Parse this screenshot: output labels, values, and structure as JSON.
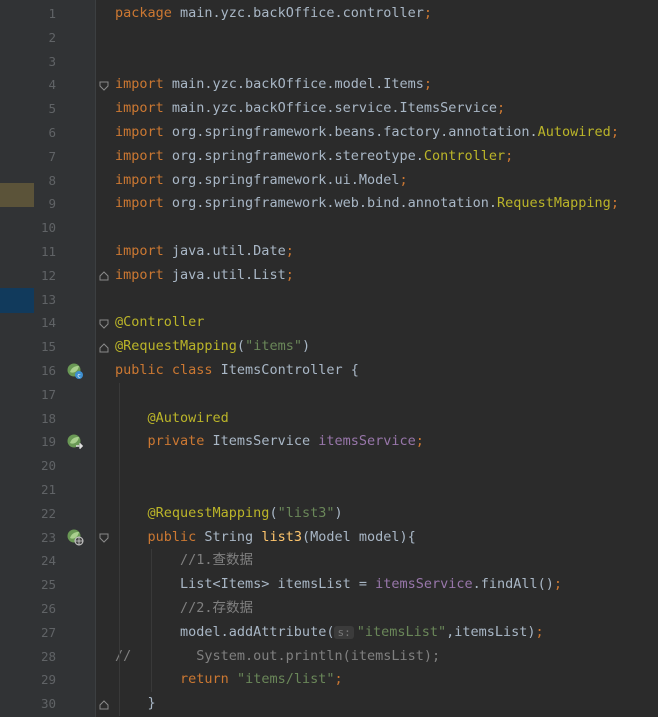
{
  "editor": {
    "lines": [
      {
        "num": "1",
        "parts": [
          {
            "t": "kw",
            "v": "package "
          },
          {
            "t": "plain",
            "v": "main.yzc.backOffice.controller"
          },
          {
            "t": "kw",
            "v": ";"
          }
        ]
      },
      {
        "num": "2",
        "parts": []
      },
      {
        "num": "3",
        "parts": []
      },
      {
        "num": "4",
        "fold": "open",
        "parts": [
          {
            "t": "kw",
            "v": "import "
          },
          {
            "t": "plain",
            "v": "main.yzc.backOffice.model.Items"
          },
          {
            "t": "kw",
            "v": ";"
          }
        ]
      },
      {
        "num": "5",
        "parts": [
          {
            "t": "kw",
            "v": "import "
          },
          {
            "t": "plain",
            "v": "main.yzc.backOffice.service.ItemsService"
          },
          {
            "t": "kw",
            "v": ";"
          }
        ]
      },
      {
        "num": "6",
        "parts": [
          {
            "t": "kw",
            "v": "import "
          },
          {
            "t": "plain",
            "v": "org.springframework.beans.factory.annotation."
          },
          {
            "t": "ann",
            "v": "Autowired"
          },
          {
            "t": "kw",
            "v": ";"
          }
        ]
      },
      {
        "num": "7",
        "parts": [
          {
            "t": "kw",
            "v": "import "
          },
          {
            "t": "plain",
            "v": "org.springframework.stereotype."
          },
          {
            "t": "ann",
            "v": "Controller"
          },
          {
            "t": "kw",
            "v": ";"
          }
        ]
      },
      {
        "num": "8",
        "parts": [
          {
            "t": "kw",
            "v": "import "
          },
          {
            "t": "plain",
            "v": "org.springframework.ui.Model"
          },
          {
            "t": "kw",
            "v": ";"
          }
        ]
      },
      {
        "num": "9",
        "parts": [
          {
            "t": "kw",
            "v": "import "
          },
          {
            "t": "plain",
            "v": "org.springframework.web.bind.annotation."
          },
          {
            "t": "ann",
            "v": "RequestMapping"
          },
          {
            "t": "kw",
            "v": ";"
          }
        ]
      },
      {
        "num": "10",
        "parts": []
      },
      {
        "num": "11",
        "parts": [
          {
            "t": "kw",
            "v": "import "
          },
          {
            "t": "plain",
            "v": "java.util.Date"
          },
          {
            "t": "kw",
            "v": ";"
          }
        ]
      },
      {
        "num": "12",
        "fold": "close",
        "parts": [
          {
            "t": "kw",
            "v": "import "
          },
          {
            "t": "plain",
            "v": "java.util.List"
          },
          {
            "t": "kw",
            "v": ";"
          }
        ]
      },
      {
        "num": "13",
        "parts": []
      },
      {
        "num": "14",
        "fold": "open",
        "parts": [
          {
            "t": "ann",
            "v": "@Controller"
          }
        ]
      },
      {
        "num": "15",
        "fold": "close",
        "parts": [
          {
            "t": "ann",
            "v": "@RequestMapping"
          },
          {
            "t": "plain",
            "v": "("
          },
          {
            "t": "str",
            "v": "\"items\""
          },
          {
            "t": "plain",
            "v": ")"
          }
        ]
      },
      {
        "num": "16",
        "icon": "spring-bean-icon",
        "parts": [
          {
            "t": "kw",
            "v": "public class "
          },
          {
            "t": "plain",
            "v": "ItemsController {"
          }
        ]
      },
      {
        "num": "17",
        "parts": []
      },
      {
        "num": "18",
        "parts": [
          {
            "t": "plain",
            "v": "    "
          },
          {
            "t": "ann",
            "v": "@Autowired"
          }
        ]
      },
      {
        "num": "19",
        "icon": "spring-autowired-icon",
        "parts": [
          {
            "t": "plain",
            "v": "    "
          },
          {
            "t": "kw",
            "v": "private "
          },
          {
            "t": "plain",
            "v": "ItemsService "
          },
          {
            "t": "fld",
            "v": "itemsService"
          },
          {
            "t": "kw",
            "v": ";"
          }
        ]
      },
      {
        "num": "20",
        "parts": []
      },
      {
        "num": "21",
        "parts": []
      },
      {
        "num": "22",
        "parts": [
          {
            "t": "plain",
            "v": "    "
          },
          {
            "t": "ann",
            "v": "@RequestMapping"
          },
          {
            "t": "plain",
            "v": "("
          },
          {
            "t": "str",
            "v": "\"list3\""
          },
          {
            "t": "plain",
            "v": ")"
          }
        ]
      },
      {
        "num": "23",
        "icon": "spring-web-icon",
        "fold": "open",
        "parts": [
          {
            "t": "plain",
            "v": "    "
          },
          {
            "t": "kw",
            "v": "public "
          },
          {
            "t": "plain",
            "v": "String "
          },
          {
            "t": "fn",
            "v": "list3"
          },
          {
            "t": "plain",
            "v": "(Model model){"
          }
        ]
      },
      {
        "num": "24",
        "parts": [
          {
            "t": "plain",
            "v": "        "
          },
          {
            "t": "com",
            "v": "//1.查数据"
          }
        ]
      },
      {
        "num": "25",
        "parts": [
          {
            "t": "plain",
            "v": "        List<Items> itemsList = "
          },
          {
            "t": "fld",
            "v": "itemsService"
          },
          {
            "t": "plain",
            "v": ".findAll()"
          },
          {
            "t": "kw",
            "v": ";"
          }
        ]
      },
      {
        "num": "26",
        "parts": [
          {
            "t": "plain",
            "v": "        "
          },
          {
            "t": "com",
            "v": "//2.存数据"
          }
        ]
      },
      {
        "num": "27",
        "parts": [
          {
            "t": "plain",
            "v": "        model.addAttribute("
          },
          {
            "t": "hint",
            "v": "s:"
          },
          {
            "t": "str",
            "v": "\"itemsList\""
          },
          {
            "t": "plain",
            "v": ",itemsList)"
          },
          {
            "t": "kw",
            "v": ";"
          }
        ]
      },
      {
        "num": "28",
        "parts": [
          {
            "t": "com",
            "v": "//        System.out.println(itemsList);"
          }
        ]
      },
      {
        "num": "29",
        "parts": [
          {
            "t": "plain",
            "v": "        "
          },
          {
            "t": "kw",
            "v": "return "
          },
          {
            "t": "str",
            "v": "\"items/list\""
          },
          {
            "t": "kw",
            "v": ";"
          }
        ]
      },
      {
        "num": "30",
        "fold": "close",
        "parts": [
          {
            "t": "plain",
            "v": "    }"
          }
        ]
      }
    ]
  }
}
